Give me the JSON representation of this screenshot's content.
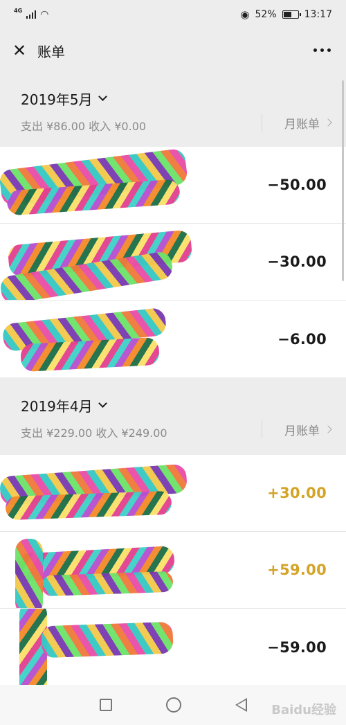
{
  "status_bar": {
    "network": "4G",
    "battery_percent": "52%",
    "time": "13:17"
  },
  "nav": {
    "title": "账单"
  },
  "months": [
    {
      "title": "2019年5月",
      "summary": "支出 ¥86.00 收入 ¥0.00",
      "bill_link": "月账单",
      "transactions": [
        {
          "amount": "−50.00",
          "type": "expense"
        },
        {
          "amount": "−30.00",
          "type": "expense"
        },
        {
          "amount": "−6.00",
          "type": "expense"
        }
      ]
    },
    {
      "title": "2019年4月",
      "summary": "支出 ¥229.00 收入 ¥249.00",
      "bill_link": "月账单",
      "transactions": [
        {
          "amount": "+30.00",
          "type": "income"
        },
        {
          "amount": "+59.00",
          "type": "income"
        },
        {
          "amount": "−59.00",
          "type": "expense"
        }
      ]
    }
  ],
  "colors": {
    "income": "#d4a427",
    "expense": "#1a1a1a",
    "background": "#ededed"
  },
  "watermark": "Baidu经验"
}
